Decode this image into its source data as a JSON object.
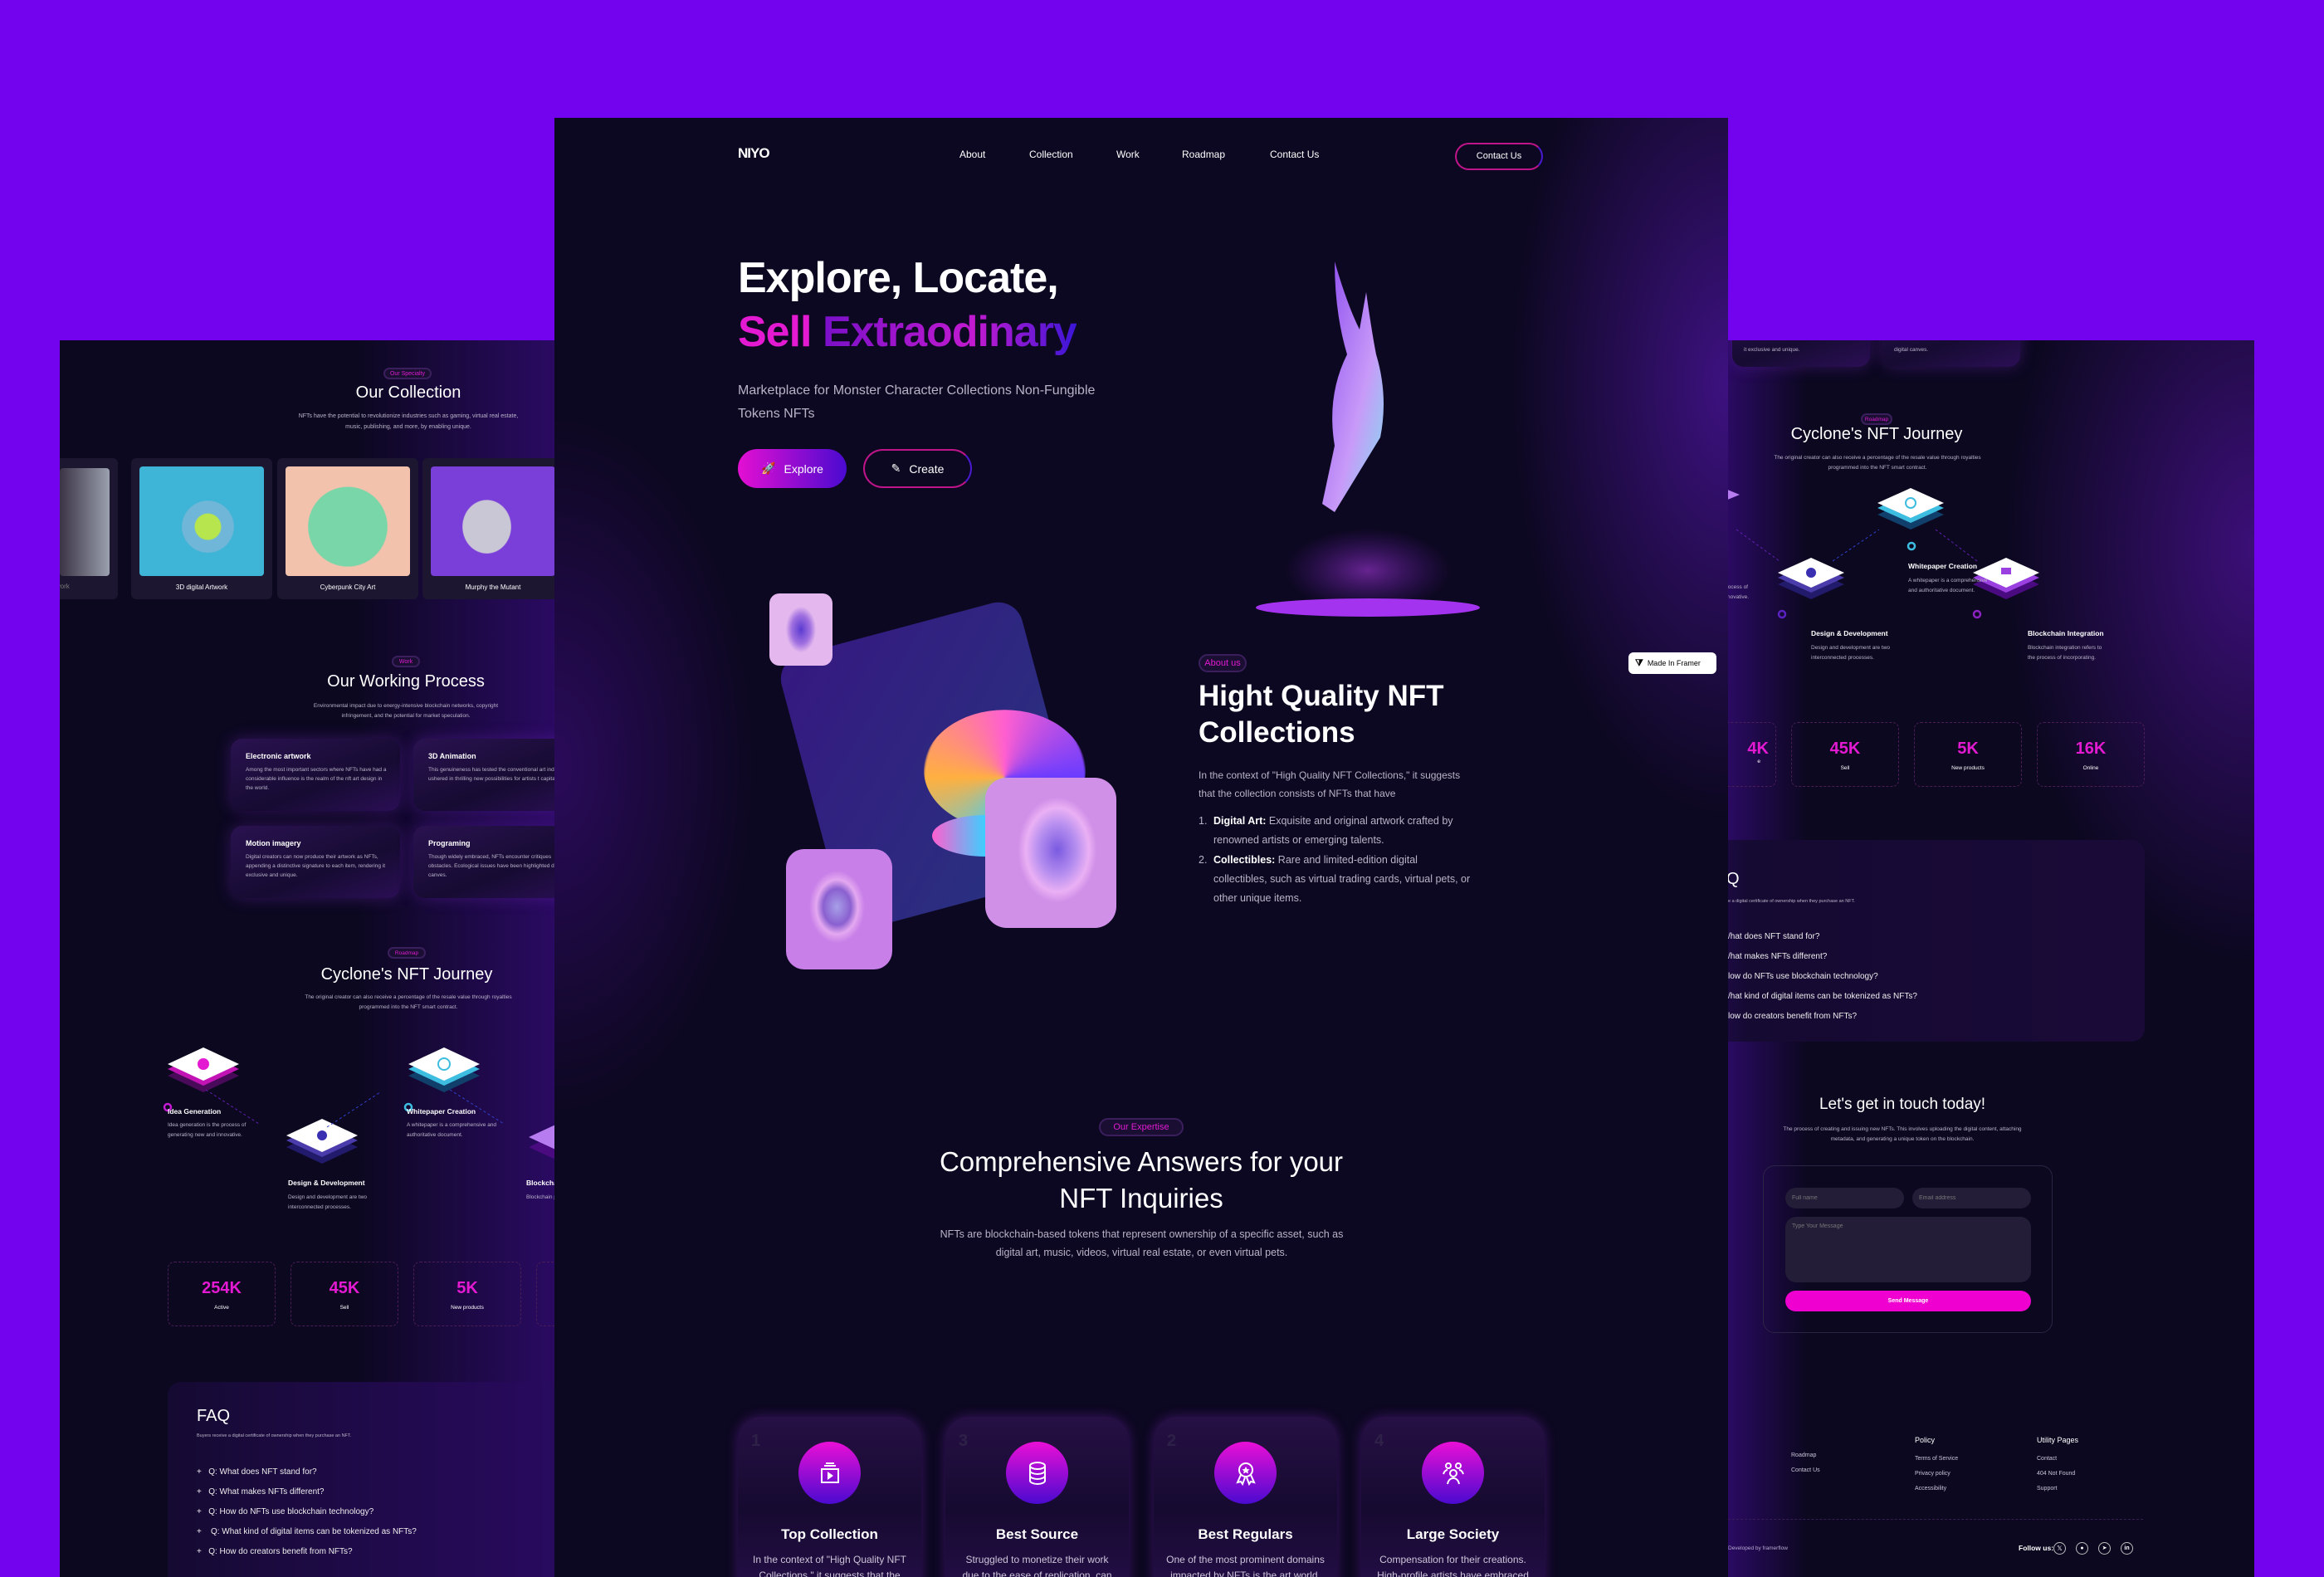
{
  "colors": {
    "page_bg": "#7302ee",
    "panel_bg": "#0d0821",
    "accent_pink": "#e41ad2",
    "accent_blue": "#3b16d6"
  },
  "center": {
    "logo": "NIYO",
    "nav": [
      "About",
      "Collection",
      "Work",
      "Roadmap",
      "Contact Us"
    ],
    "contact_button": "Contact Us",
    "hero": {
      "line1": "Explore, Locate,",
      "line2a": "Sell ",
      "line2b": "Extraodinary",
      "subtitle": "Marketplace for Monster Character  Collections Non-Fungible Tokens NFTs",
      "explore": "Explore",
      "create": "Create",
      "explore_icon": "rocket-icon",
      "create_icon": "pencil-icon"
    },
    "framer_badge": "Made In Framer",
    "about": {
      "pill": "About us",
      "title": "Hight Quality NFT Collections",
      "intro": "In the context of \"High Quality NFT Collections,\" it suggests that the collection consists of NFTs that have",
      "items": [
        {
          "num": "1.",
          "bold": "Digital Art:",
          "text": " Exquisite and original artwork crafted by renowned artists or emerging talents."
        },
        {
          "num": "2.",
          "bold": "Collectibles:",
          "text": " Rare and limited-edition digital collectibles, such as virtual trading cards, virtual pets, or other unique items."
        }
      ]
    },
    "expertise": {
      "pill": "Our Expertise",
      "title": "Comprehensive Answers for your NFT Inquiries",
      "text": "NFTs are blockchain-based tokens that represent ownership of a specific asset, such as digital art, music, videos, virtual real estate, or even virtual pets.",
      "cards": [
        {
          "num": "1",
          "icon": "video-collection-icon",
          "title": "Top Collection",
          "text": "In the context of \"High Quality NFT Collections,\" it suggests that the collection consists of NFTs."
        },
        {
          "num": "3",
          "icon": "coin-stack-icon",
          "title": "Best Source",
          "text": "Struggled to monetize their work due to the ease of replication, can now create limited editions."
        },
        {
          "num": "2",
          "icon": "award-badge-icon",
          "title": "Best Regulars",
          "text": "One of the most prominent domains impacted by NFTs is the art world. Digital artists, who previously."
        },
        {
          "num": "4",
          "icon": "community-icon",
          "title": "Large Society",
          "text": "Compensation for their creations. High-profile artists have embraced NFTs, producing unique."
        }
      ]
    }
  },
  "left": {
    "collection": {
      "pill": "Our Specialty",
      "title": "Our Collection",
      "text": "NFTs have the potential to revolutionize industries such as gaming, virtual real estate, music, publishing, and more, by enabling unique.",
      "items": [
        "rtwork",
        "3D digital Artwork",
        "Cyberpunk City Art",
        "Murphy the Mutant"
      ]
    },
    "work": {
      "pill": "Work",
      "title": "Our Working Process",
      "text": "Environmental impact due to energy-intensive blockchain networks, copyright infringement, and the potential for market speculation.",
      "cards": [
        {
          "title": "Electronic artwork",
          "text": "Among the most important sectors where NFTs have had a considerable influence is the realm of the nft art design in the world."
        },
        {
          "title": "3D Animation",
          "text": "This genuineness has tested the conventional art ind and ushered in thrilling new possibilities for artists t capitalize."
        },
        {
          "title": "Motion imagery",
          "text": "Digital creators can now produce their artwork as NFTs, appending a distinctive signature to each item, rendering it exclusive and unique."
        },
        {
          "title": "Programing",
          "text": "Though widely embraced, NFTs encounter critiques obstacles. Ecological issues have been highlighted digital canves."
        }
      ]
    },
    "roadmap": {
      "pill": "Roadmap",
      "title": "Cyclone's NFT Journey",
      "text": "The original creator can also receive a percentage of the resale value through royalties programmed into the NFT smart contract.",
      "steps": [
        {
          "title": "Idea Generation",
          "text": "Idea generation is the process of generating new and innovative."
        },
        {
          "title": "Design & Development",
          "text": "Design and development are two interconnected processes."
        },
        {
          "title": "Whitepaper Creation",
          "text": "A whitepaper is a comprehensive and authoritative document."
        },
        {
          "title": "Blockcha",
          "text": "Blockchain process of"
        }
      ]
    },
    "stats": [
      {
        "value": "254K",
        "label": "Active"
      },
      {
        "value": "45K",
        "label": "Sell"
      },
      {
        "value": "5K",
        "label": "New products"
      }
    ],
    "faq": {
      "title": "FAQ",
      "text": "Buyers receive a digital certificate of ownership when they purchase an NFT.",
      "questions": [
        "Q: What does NFT stand for?",
        "Q: What makes NFTs different?",
        "Q: How do NFTs use blockchain technology?",
        " Q: What kind of digital items can be tokenized as NFTs?",
        "Q: How do creators benefit from NFTs?"
      ]
    }
  },
  "right": {
    "top_cards": [
      "it exclusive and unique.",
      "digital canves."
    ],
    "roadmap": {
      "pill": "Roadmap",
      "title": "Cyclone's NFT Journey",
      "text": "The original creator can also receive a percentage of the resale value through royalties programmed into the NFT smart contract.",
      "side_text": "process of innovative.",
      "steps": [
        {
          "title": "Design & Development",
          "text": "Design and development are two interconnected processes."
        },
        {
          "title": "Whitepaper Creation",
          "text": "A whitepaper is a comprehensive and authoritative document."
        },
        {
          "title": "Blockchain Integration",
          "text": "Blockchain integration refers to the process of incorporating."
        }
      ]
    },
    "stats": [
      {
        "value": "4K",
        "label": "e"
      },
      {
        "value": "45K",
        "label": "Sell"
      },
      {
        "value": "5K",
        "label": "New products"
      },
      {
        "value": "16K",
        "label": "Online"
      }
    ],
    "faq": {
      "title": "Q",
      "text": "e a digital certificate of ownership when they purchase an NFT.",
      "questions": [
        "/hat does NFT stand for?",
        "/hat makes NFTs different?",
        "low do NFTs use blockchain technology?",
        "/hat kind of digital items can be tokenized as NFTs?",
        "low do creators benefit from NFTs?"
      ]
    },
    "contact": {
      "title": "Let's get in touch today!",
      "text": "The process of creating and issuing new NFTs. This involves uploading the digital content, attaching metadata, and generating a unique token on the blockchain.",
      "name_placeholder": "Full name",
      "email_placeholder": "Email address",
      "message_placeholder": "Type Your Message",
      "send": "Send Message"
    },
    "footer": {
      "col1": [
        "Roadmap",
        "Contact Us"
      ],
      "policy_title": "Policy",
      "policy": [
        "Terms of Service",
        "Privacy policy",
        "Accessibility"
      ],
      "utility_title": "Utility Pages",
      "utility": [
        "Contact",
        "404 Not Found",
        "Support"
      ],
      "developed": "Developed by framerflow",
      "follow": "Follow us:",
      "socials": [
        "x-icon",
        "discord-icon",
        "telegram-icon",
        "linkedin-icon"
      ]
    }
  }
}
